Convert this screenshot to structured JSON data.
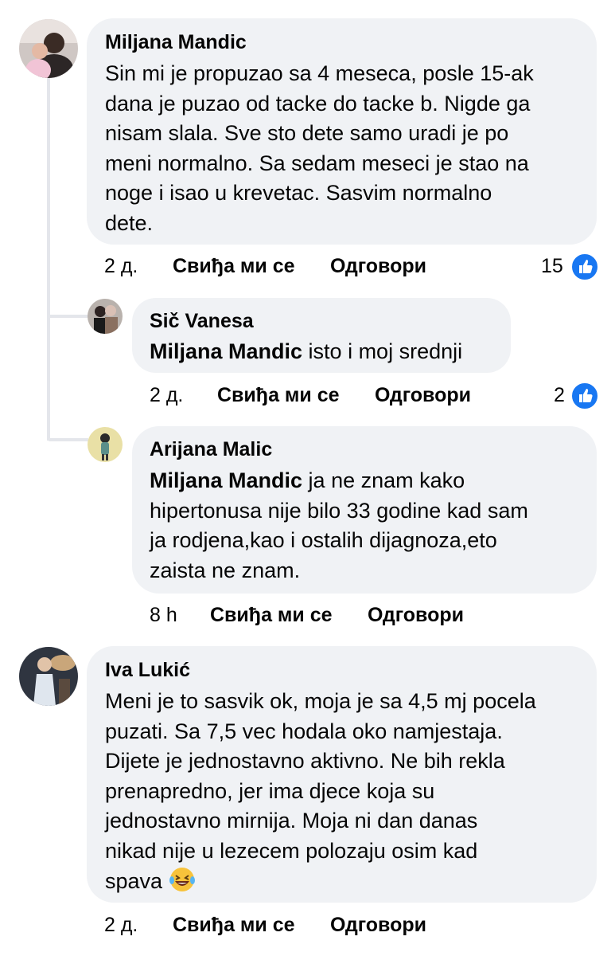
{
  "colors": {
    "bubble": "#f0f2f5",
    "like": "#1877f2",
    "thread_line": "#e4e6eb"
  },
  "comments": [
    {
      "author": "Miljana Mandic",
      "lines": [
        "Sin mi je propuzao sa 4 meseca, posle 15-ak",
        "dana je puzao od tacke do tacke b. Nigde ga",
        "nisam slala. Sve sto dete samo uradi je po",
        "meni normalno. Sa sedam meseci je stao na",
        "noge i isao u krevetac. Sasvim normalno",
        "dete."
      ],
      "time": "2 д.",
      "like_label": "Свиђа ми се",
      "reply_label": "Одговори",
      "reactions": "15",
      "reaction_icon": "thumbs-up-icon"
    },
    {
      "author": "Sič Vanesa",
      "mention": "Miljana Mandic",
      "text": " isto i moj srednji",
      "time": "2 д.",
      "like_label": "Свиђа ми се",
      "reply_label": "Одговори",
      "reactions": "2",
      "reaction_icon": "thumbs-up-icon"
    },
    {
      "author": "Arijana Malic",
      "mention": "Miljana Mandic",
      "lines": [
        " ja ne znam kako",
        "hipertonusa nije bilo 33 godine kad sam",
        "ja rodjena,kao i ostalih dijagnoza,eto",
        "zaista ne znam."
      ],
      "time": "8 h",
      "like_label": "Свиђа ми се",
      "reply_label": "Одговори"
    },
    {
      "author": "Iva Lukić",
      "lines": [
        "Meni je to sasvik ok, moja je sa 4,5 mj pocela",
        "puzati. Sa 7,5 vec hodala oko namjestaja.",
        "Dijete je jednostavno aktivno. Ne bih rekla",
        "prenapredno, jer ima djece koja su",
        "jednostavno mirnija. Moja ni dan danas",
        "nikad nije u lezecem polozaju osim kad",
        "spava "
      ],
      "emoji": "laughing-tears-emoji",
      "time": "2 д.",
      "like_label": "Свиђа ми се",
      "reply_label": "Одговори"
    }
  ]
}
